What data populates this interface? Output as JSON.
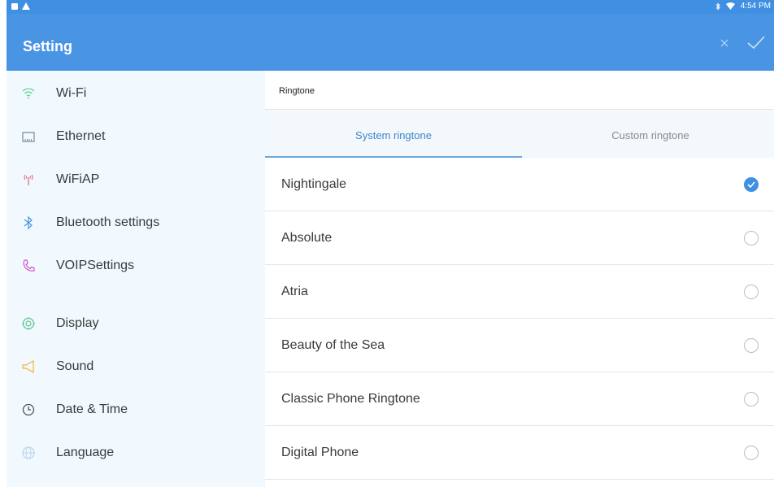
{
  "status_bar": {
    "time": "4:54 PM"
  },
  "app_bar": {
    "title": "Setting"
  },
  "sidebar": {
    "items": [
      {
        "label": "Wi-Fi",
        "icon": "wifi-icon"
      },
      {
        "label": "Ethernet",
        "icon": "ethernet-icon"
      },
      {
        "label": "WiFiAP",
        "icon": "hotspot-icon"
      },
      {
        "label": "Bluetooth settings",
        "icon": "bluetooth-icon"
      },
      {
        "label": "VOIPSettings",
        "icon": "phone-icon"
      },
      {
        "label": "Display",
        "icon": "display-icon"
      },
      {
        "label": "Sound",
        "icon": "speaker-icon"
      },
      {
        "label": "Date & Time",
        "icon": "clock-icon"
      },
      {
        "label": "Language",
        "icon": "globe-icon"
      }
    ]
  },
  "content": {
    "header": "Ringtone",
    "tabs": [
      {
        "label": "System ringtone",
        "active": true
      },
      {
        "label": "Custom ringtone",
        "active": false
      }
    ],
    "ringtones": [
      {
        "name": "Nightingale",
        "selected": true
      },
      {
        "name": "Absolute",
        "selected": false
      },
      {
        "name": "Atria",
        "selected": false
      },
      {
        "name": "Beauty of the Sea",
        "selected": false
      },
      {
        "name": "Classic Phone Ringtone",
        "selected": false
      },
      {
        "name": "Digital Phone",
        "selected": false
      }
    ]
  },
  "colors": {
    "primary": "#4a94e4",
    "sidebar_bg": "#f1f9fe",
    "tab_active": "#3d85c8"
  }
}
